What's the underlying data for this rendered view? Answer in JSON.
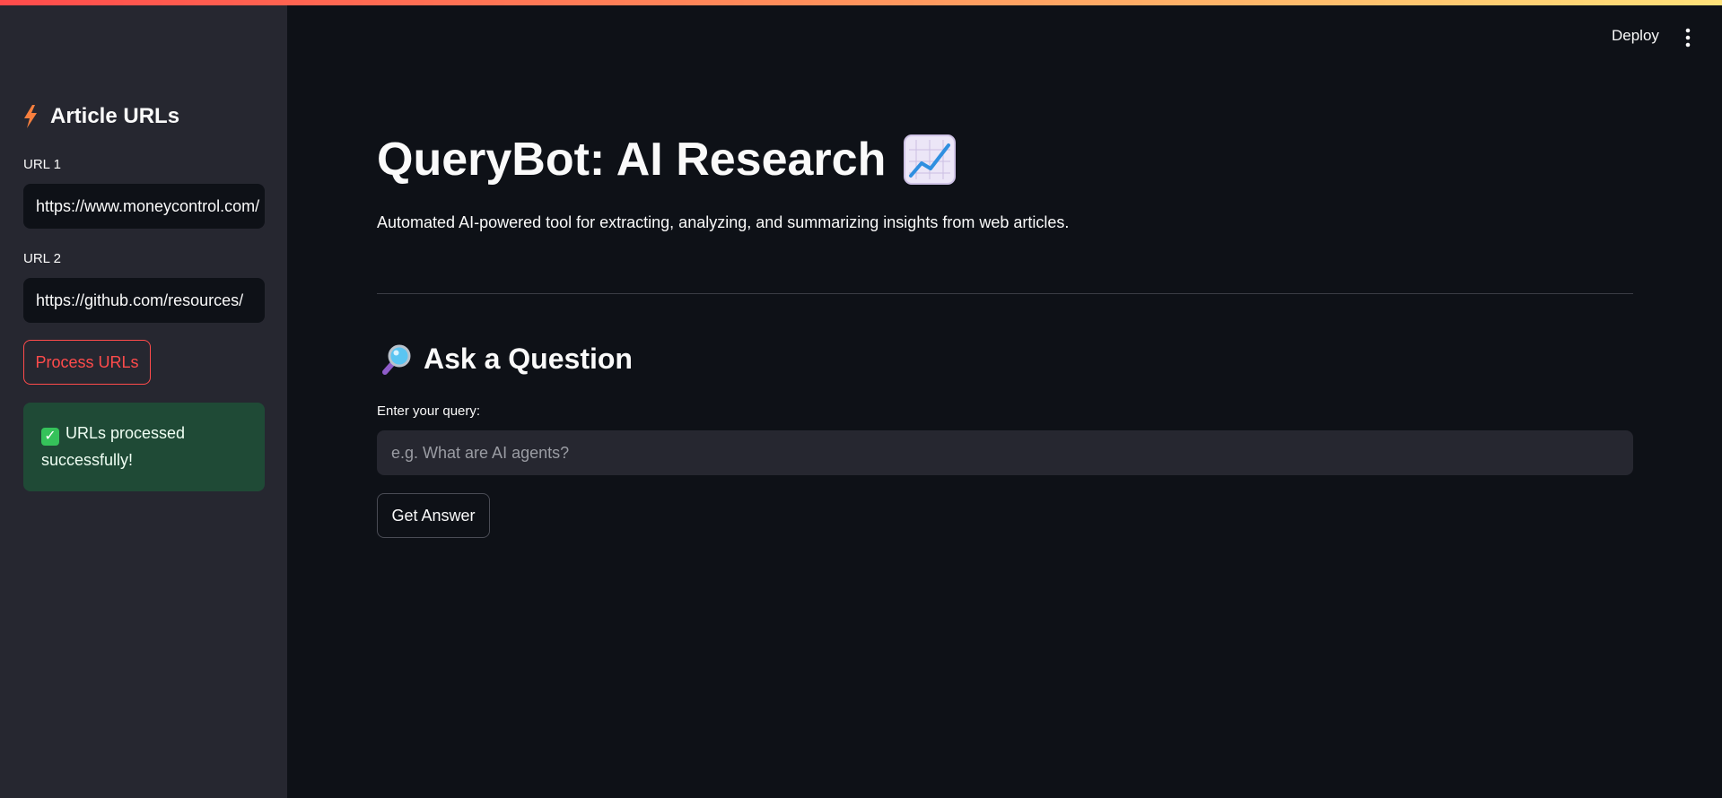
{
  "header": {
    "deploy_label": "Deploy",
    "menu_icon": "kebab-menu-icon"
  },
  "sidebar": {
    "heading": "Article URLs",
    "heading_icon": "lightning-bolt-icon",
    "url1": {
      "label": "URL 1",
      "value": "https://www.moneycontrol.com/"
    },
    "url2": {
      "label": "URL 2",
      "value": "https://github.com/resources/"
    },
    "process_button": "Process URLs",
    "success_message": "URLs processed successfully!",
    "success_icon": "check-mark-icon"
  },
  "main": {
    "title": "QueryBot: AI Research",
    "title_icon": "chart-increasing-icon",
    "subtitle": "Automated AI-powered tool for extracting, analyzing, and summarizing insights from web articles.",
    "section_heading": "Ask a Question",
    "section_icon": "magnifying-glass-icon",
    "query_label": "Enter your query:",
    "query_value": "",
    "query_placeholder": "e.g. What are AI agents?",
    "answer_button": "Get Answer"
  },
  "colors": {
    "background": "#0e1117",
    "sidebar": "#262730",
    "accent": "#ff4b4b",
    "success_bg": "#1f4a36",
    "success_check": "#35c25a"
  }
}
